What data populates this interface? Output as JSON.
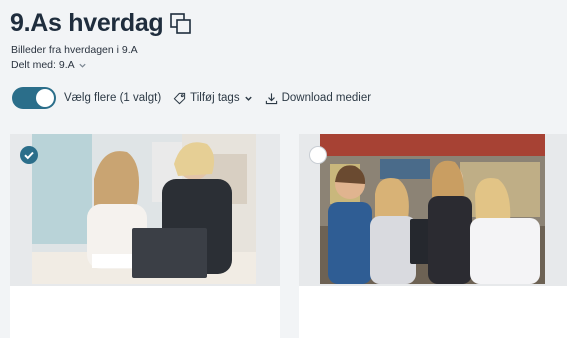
{
  "album": {
    "title": "9.As hverdag",
    "description": "Billeder fra hverdagen i 9.A",
    "shared_label": "Delt med: 9.A"
  },
  "toolbar": {
    "select_multiple": "Vælg flere (1 valgt)",
    "add_tags": "Tilføj tags",
    "download": "Download medier"
  },
  "colors": {
    "accent": "#2b6e8a",
    "background": "#f2f4f6"
  },
  "icons": {
    "copy": "copy-icon",
    "chevron": "chevron-down-icon",
    "tag": "tag-icon",
    "download": "download-icon",
    "check": "check-icon"
  },
  "media": [
    {
      "selected": true
    },
    {
      "selected": false
    }
  ]
}
